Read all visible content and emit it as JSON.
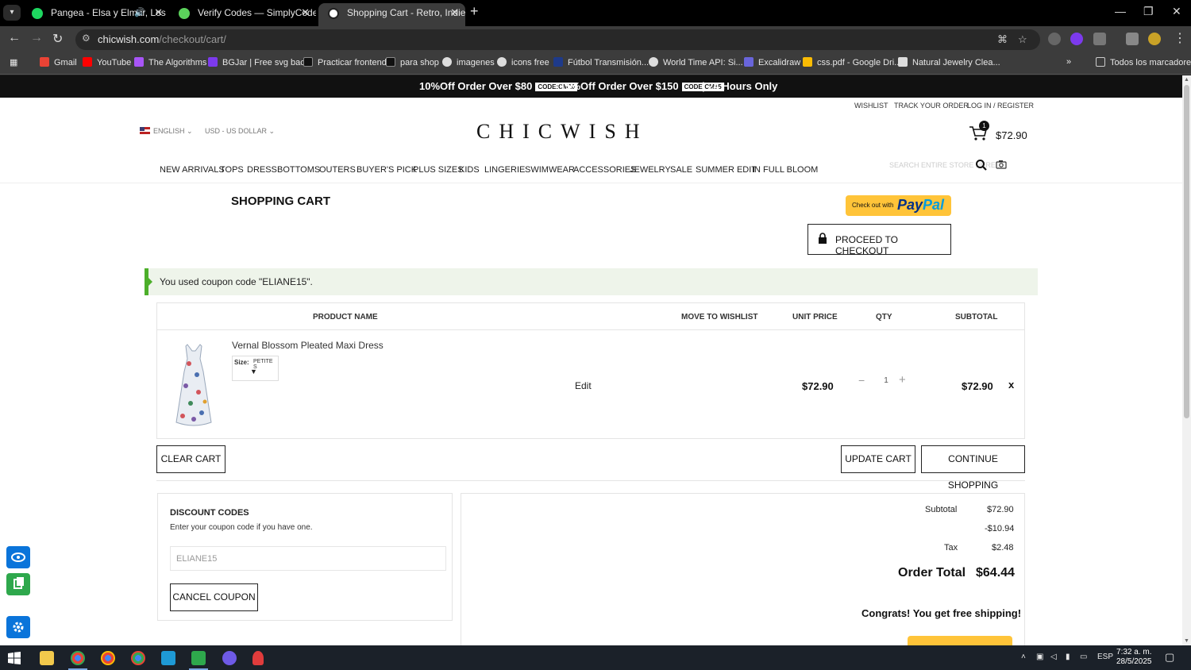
{
  "browser": {
    "tabs": [
      {
        "title": "Pangea - Elsa y Elmar, Los N",
        "color": "#1ed760",
        "active": false
      },
      {
        "title": "Verify Codes — SimplyCodes",
        "color": "#5bd25b",
        "active": false
      },
      {
        "title": "Shopping Cart - Retro, Indie an",
        "color": "#222222",
        "active": true
      }
    ],
    "url_host": "chicwish.com",
    "url_path": "/checkout/cart/",
    "bookmarks": [
      {
        "label": "Gmail",
        "color": "#ea4335"
      },
      {
        "label": "YouTube",
        "color": "#ff0000"
      },
      {
        "label": "The Algorithms",
        "color": "#a855f7"
      },
      {
        "label": "BGJar | Free svg bac...",
        "color": "#7c3aed"
      },
      {
        "label": "Practicar frontend",
        "color": "#111111"
      },
      {
        "label": "para shop",
        "color": "#111111"
      },
      {
        "label": "imagenes",
        "color": "#dddddd"
      },
      {
        "label": "icons free",
        "color": "#dddddd"
      },
      {
        "label": "Fútbol Transmisión...",
        "color": "#1e3a8a"
      },
      {
        "label": "World Time API: Si...",
        "color": "#dddddd"
      },
      {
        "label": "Excalidraw",
        "color": "#6965db"
      },
      {
        "label": "css.pdf - Google Dri...",
        "color": "#fbbc04"
      },
      {
        "label": "Natural Jewelry Clea...",
        "color": "#dddddd"
      }
    ],
    "all_bookmarks": "Todos los marcadores"
  },
  "promo": {
    "offer1": "10%Off Order Over $80",
    "code1": "CODE:CM10",
    "offer2": "15%Off Order Over $150",
    "code2": "CODE:CM15",
    "offer3": "|  24 Hours Only"
  },
  "header": {
    "wishlist": "WISHLIST",
    "track": "TRACK YOUR ORDER",
    "login": "LOG IN / REGISTER",
    "language": "ENGLISH",
    "currency": "USD - US DOLLAR",
    "logo": "CHICWISH",
    "cart_count": "1",
    "cart_total": "$72.90",
    "search_placeholder": "SEARCH ENTIRE STORE HERE..."
  },
  "nav": [
    "NEW ARRIVALS",
    "TOPS",
    "DRESS",
    "BOTTOMS",
    "OUTERS",
    "BUYER'S PICK",
    "PLUS SIZES",
    "KIDS",
    "LINGERIE",
    "SWIMWEAR",
    "ACCESSORIES",
    "JEWELRY",
    "SALE",
    "SUMMER EDIT",
    "IN FULL BLOOM"
  ],
  "cart": {
    "title": "SHOPPING CART",
    "paypal_checkout": "Check out with",
    "paypal_pay": "Pay",
    "paypal_pal": "Pal",
    "proceed": "PROCEED TO CHECKOUT",
    "coupon_message": "You used coupon code \"ELIANE15\".",
    "columns": {
      "product": "PRODUCT NAME",
      "wishlist": "MOVE TO WISHLIST",
      "unit_price": "UNIT PRICE",
      "qty": "QTY",
      "subtotal": "SUBTOTAL"
    },
    "item": {
      "name": "Vernal Blossom Pleated Maxi Dress",
      "size_label": "Size:",
      "size_value": "PETITE S",
      "edit": "Edit",
      "unit_price": "$72.90",
      "qty": "1",
      "subtotal": "$72.90",
      "remove": "x"
    },
    "clear_cart": "CLEAR CART",
    "update_cart": "UPDATE CART",
    "continue_shopping": "CONTINUE SHOPPING"
  },
  "discount": {
    "heading": "DISCOUNT CODES",
    "sub": "Enter your coupon code if you have one.",
    "code_value": "ELIANE15",
    "cancel": "CANCEL COUPON"
  },
  "totals": {
    "subtotal_label": "Subtotal",
    "subtotal_value": "$72.90",
    "discount_value": "-$10.94",
    "tax_label": "Tax",
    "tax_value": "$2.48",
    "order_total_label": "Order Total",
    "order_total_value": "$64.44",
    "shipping_note": "Congrats! You get free shipping!"
  },
  "taskbar": {
    "lang": "ESP",
    "time": "7:32 a. m.",
    "date": "28/5/2025"
  }
}
